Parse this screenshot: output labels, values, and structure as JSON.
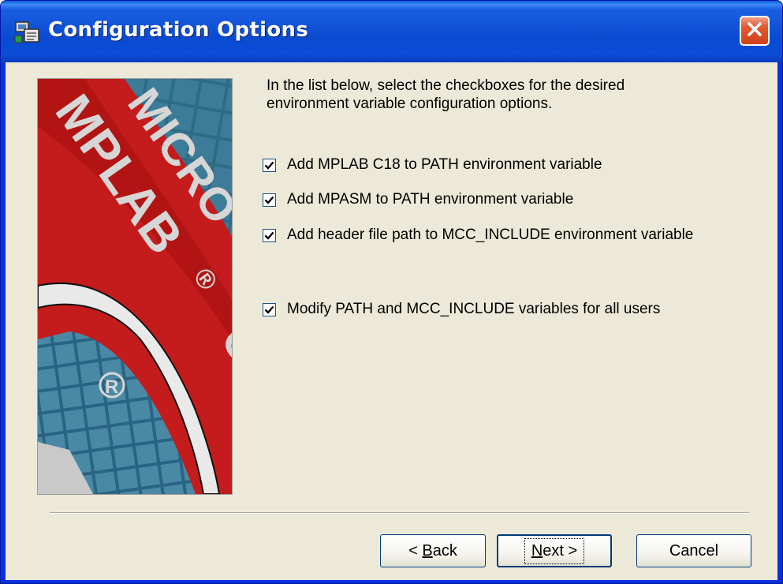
{
  "window": {
    "title": "Configuration Options"
  },
  "intro_text": "In the list below, select the checkboxes for the desired environment variable configuration options.",
  "banner": {
    "product_text": "MICROCHIP MPLAB C"
  },
  "options": [
    {
      "label": "Add MPLAB C18 to PATH environment variable",
      "checked": true
    },
    {
      "label": "Add MPASM to PATH environment variable",
      "checked": true
    },
    {
      "label": "Add header file path to MCC_INCLUDE environment variable",
      "checked": true
    },
    {
      "label": "Modify PATH and MCC_INCLUDE variables for all users",
      "checked": true
    }
  ],
  "buttons": {
    "back_prefix": "< ",
    "back_mnemonic": "B",
    "back_rest": "ack",
    "next_mnemonic": "N",
    "next_rest": "ext >",
    "cancel": "Cancel"
  },
  "colors": {
    "title_bar": "#0a4ad0",
    "client_bg": "#ece9d8",
    "close_button": "#d2411c",
    "banner_red": "#c41c1c",
    "banner_blue": "#2f6a86"
  }
}
